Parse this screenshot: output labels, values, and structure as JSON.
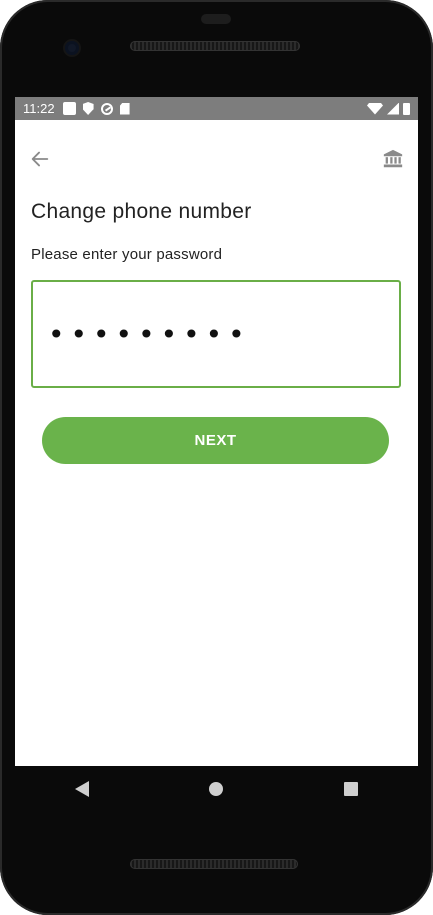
{
  "status_bar": {
    "time": "11:22",
    "left_icons": [
      "square-notification-icon",
      "shield-icon",
      "dnd-icon",
      "sd-card-icon"
    ],
    "right_icons": [
      "wifi-icon",
      "cell-signal-icon",
      "battery-icon"
    ]
  },
  "app_bar": {
    "back_icon": "arrow-left-icon",
    "bank_icon": "bank-icon"
  },
  "page": {
    "title": "Change phone number",
    "subtitle": "Please enter your password"
  },
  "password_field": {
    "value": "•••••••••",
    "focused": true
  },
  "next_button": {
    "label": "NEXT",
    "color": "#6ab34b"
  },
  "colors": {
    "accent": "#6aae47",
    "statusbar": "#7d7d7d"
  },
  "nav_bar": {
    "buttons": [
      "back-icon",
      "home-icon",
      "recents-icon"
    ]
  }
}
